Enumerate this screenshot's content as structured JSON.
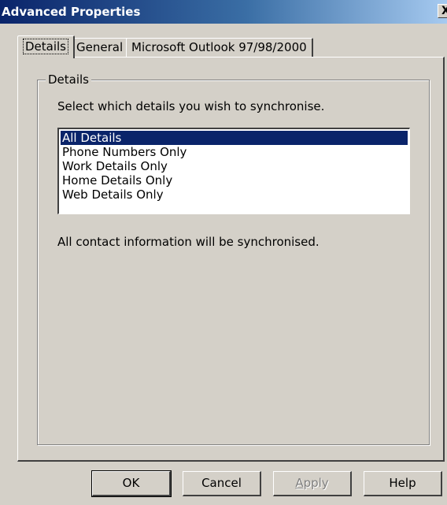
{
  "window": {
    "title": "Advanced Properties",
    "close_label": "X"
  },
  "tabs": [
    {
      "label": "Details",
      "active": true
    },
    {
      "label": "General",
      "active": false
    },
    {
      "label": "Microsoft Outlook 97/98/2000",
      "active": false
    }
  ],
  "details": {
    "group_label": "Details",
    "instruction": "Select which details you wish to synchronise.",
    "options": [
      {
        "label": "All Details",
        "selected": true
      },
      {
        "label": "Phone Numbers Only",
        "selected": false
      },
      {
        "label": "Work Details Only",
        "selected": false
      },
      {
        "label": "Home Details Only",
        "selected": false
      },
      {
        "label": "Web Details Only",
        "selected": false
      }
    ],
    "status_text": "All contact information will be synchronised."
  },
  "buttons": {
    "ok": "OK",
    "cancel": "Cancel",
    "apply_first": "A",
    "apply_rest": "pply",
    "help": "Help"
  },
  "colors": {
    "face": "#d4d0c8",
    "title_start": "#0a246a",
    "selection": "#0a246a"
  }
}
